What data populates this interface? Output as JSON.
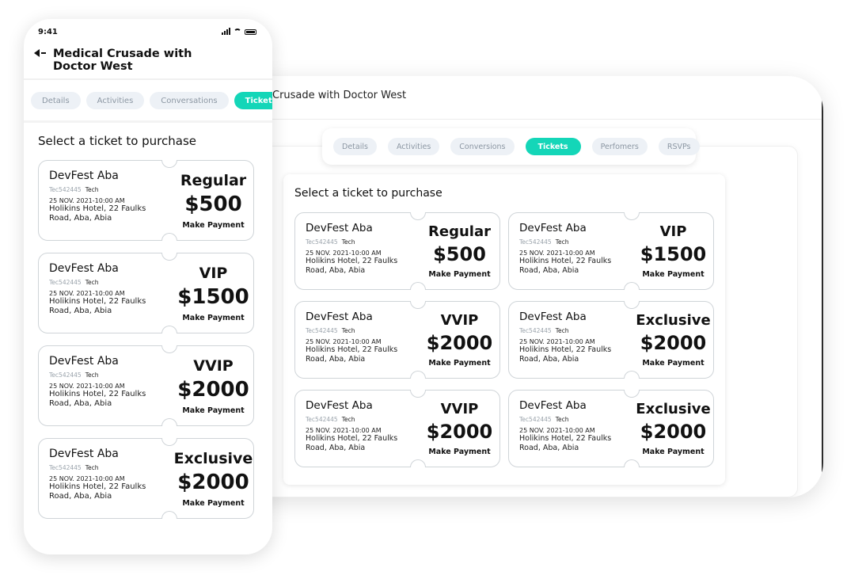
{
  "desktop": {
    "title": "Crusade with Doctor West",
    "tabs": [
      {
        "label": "Details",
        "active": false
      },
      {
        "label": "Activities",
        "active": false
      },
      {
        "label": "Conversions",
        "active": false
      },
      {
        "label": "Tickets",
        "active": true
      },
      {
        "label": "Perfomers",
        "active": false
      },
      {
        "label": "RSVPs",
        "active": false
      }
    ],
    "heading": "Select a ticket to purchase",
    "tickets": [
      {
        "event": "DevFest Aba",
        "code": "Tec542445",
        "category": "Tech",
        "date": "25 NOV. 2021-10:00 AM",
        "venue": "Holikins Hotel, 22 Faulks Road, Aba, Abia",
        "type": "Regular",
        "price": "$500",
        "action": "Make Payment"
      },
      {
        "event": "DevFest Aba",
        "code": "Tec542445",
        "category": "Tech",
        "date": "25 NOV. 2021-10:00 AM",
        "venue": "Holikins Hotel, 22 Faulks Road, Aba, Abia",
        "type": "VIP",
        "price": "$1500",
        "action": "Make Payment"
      },
      {
        "event": "DevFest Aba",
        "code": "Tec542445",
        "category": "Tech",
        "date": "25 NOV. 2021-10:00 AM",
        "venue": "Holikins Hotel, 22 Faulks Road, Aba, Abia",
        "type": "VVIP",
        "price": "$2000",
        "action": "Make Payment"
      },
      {
        "event": "DevFest Aba",
        "code": "Tec542445",
        "category": "Tech",
        "date": "25 NOV. 2021-10:00 AM",
        "venue": "Holikins Hotel, 22 Faulks Road, Aba, Abia",
        "type": "Exclusive",
        "price": "$2000",
        "action": "Make Payment"
      },
      {
        "event": "DevFest Aba",
        "code": "Tec542445",
        "category": "Tech",
        "date": "25 NOV. 2021-10:00 AM",
        "venue": "Holikins Hotel, 22 Faulks Road, Aba, Abia",
        "type": "VVIP",
        "price": "$2000",
        "action": "Make Payment"
      },
      {
        "event": "DevFest Aba",
        "code": "Tec542445",
        "category": "Tech",
        "date": "25 NOV. 2021-10:00 AM",
        "venue": "Holikins Hotel, 22 Faulks Road, Aba, Abia",
        "type": "Exclusive",
        "price": "$2000",
        "action": "Make Payment"
      }
    ]
  },
  "phone": {
    "time": "9:41",
    "title": "Medical Crusade with Doctor West",
    "tabs": [
      {
        "label": "Details",
        "active": false
      },
      {
        "label": "Activities",
        "active": false
      },
      {
        "label": "Conversations",
        "active": false
      },
      {
        "label": "Tickets",
        "active": true
      }
    ],
    "heading": "Select a ticket to purchase",
    "tickets": [
      {
        "event": "DevFest Aba",
        "code": "Tec542445",
        "category": "Tech",
        "date": "25 NOV. 2021-10:00 AM",
        "venue": "Holikins Hotel, 22 Faulks Road, Aba, Abia",
        "type": "Regular",
        "price": "$500",
        "action": "Make Payment"
      },
      {
        "event": "DevFest Aba",
        "code": "Tec542445",
        "category": "Tech",
        "date": "25 NOV. 2021-10:00 AM",
        "venue": "Holikins Hotel, 22 Faulks Road, Aba, Abia",
        "type": "VIP",
        "price": "$1500",
        "action": "Make Payment"
      },
      {
        "event": "DevFest Aba",
        "code": "Tec542445",
        "category": "Tech",
        "date": "25 NOV. 2021-10:00 AM",
        "venue": "Holikins Hotel, 22 Faulks Road, Aba, Abia",
        "type": "VVIP",
        "price": "$2000",
        "action": "Make Payment"
      },
      {
        "event": "DevFest Aba",
        "code": "Tec542445",
        "category": "Tech",
        "date": "25 NOV. 2021-10:00 AM",
        "venue": "Holikins Hotel, 22 Faulks Road, Aba, Abia",
        "type": "Exclusive",
        "price": "$2000",
        "action": "Make Payment"
      }
    ]
  },
  "colors": {
    "accent": "#14d6b8",
    "tab_inactive_bg": "#edf1f6",
    "tab_inactive_text": "#8c97a3"
  },
  "icons": {
    "back": "back-arrow-icon",
    "signal": "signal-icon",
    "wifi": "wifi-icon",
    "battery": "battery-icon"
  }
}
